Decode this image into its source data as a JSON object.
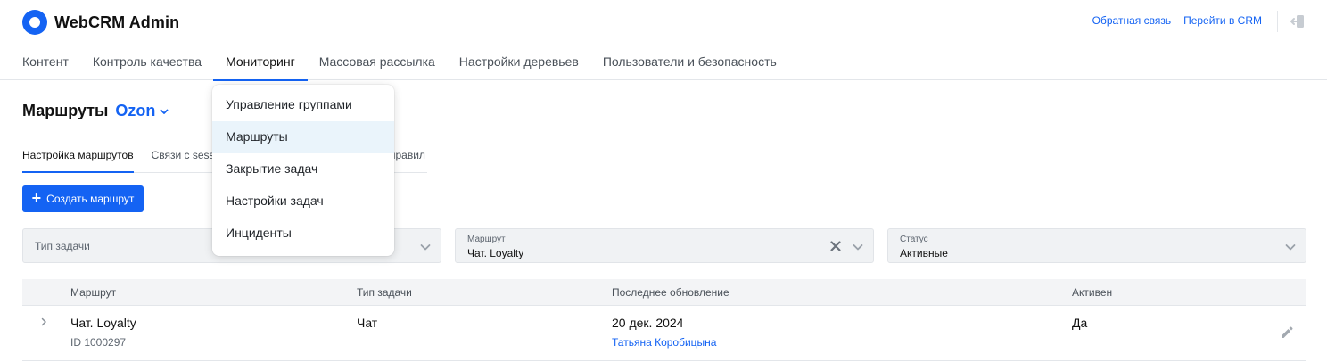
{
  "app": {
    "title": "WebCRM Admin"
  },
  "header": {
    "feedback_link": "Обратная связь",
    "crm_link": "Перейти в CRM"
  },
  "nav": {
    "items": [
      {
        "label": "Контент"
      },
      {
        "label": "Контроль качества"
      },
      {
        "label": "Мониторинг"
      },
      {
        "label": "Массовая рассылка"
      },
      {
        "label": "Настройки деревьев"
      },
      {
        "label": "Пользователи и безопасность"
      }
    ],
    "active": "Мониторинг"
  },
  "dropdown": {
    "items": [
      {
        "label": "Управление группами"
      },
      {
        "label": "Маршруты"
      },
      {
        "label": "Закрытие задач"
      },
      {
        "label": "Настройки задач"
      },
      {
        "label": "Инциденты"
      }
    ],
    "hovered": "Маршруты"
  },
  "page": {
    "title": "Маршруты",
    "project": "Ozon"
  },
  "subtabs": {
    "items": [
      {
        "label": "Настройка маршрутов"
      },
      {
        "label": "Связи с sess"
      }
    ],
    "tail_fragment": "правил"
  },
  "create_button": {
    "label": "Создать маршрут"
  },
  "filters": {
    "task_type": {
      "placeholder": "Тип задачи"
    },
    "route": {
      "label": "Маршрут",
      "value": "Чат. Loyalty"
    },
    "status": {
      "label": "Статус",
      "value": "Активные"
    }
  },
  "table": {
    "columns": [
      "Маршрут",
      "Тип задачи",
      "Последнее обновление",
      "Активен"
    ],
    "rows": [
      {
        "route": "Чат. Loyalty",
        "id": "ID 1000297",
        "task_type": "Чат",
        "updated_date": "20 дек. 2024",
        "updated_by": "Татьяна Коробицына",
        "active": "Да"
      }
    ]
  },
  "colors": {
    "accent": "#1463f3",
    "menu_hover": "#eaf4fb",
    "filter_bg": "#f0f2f4"
  }
}
